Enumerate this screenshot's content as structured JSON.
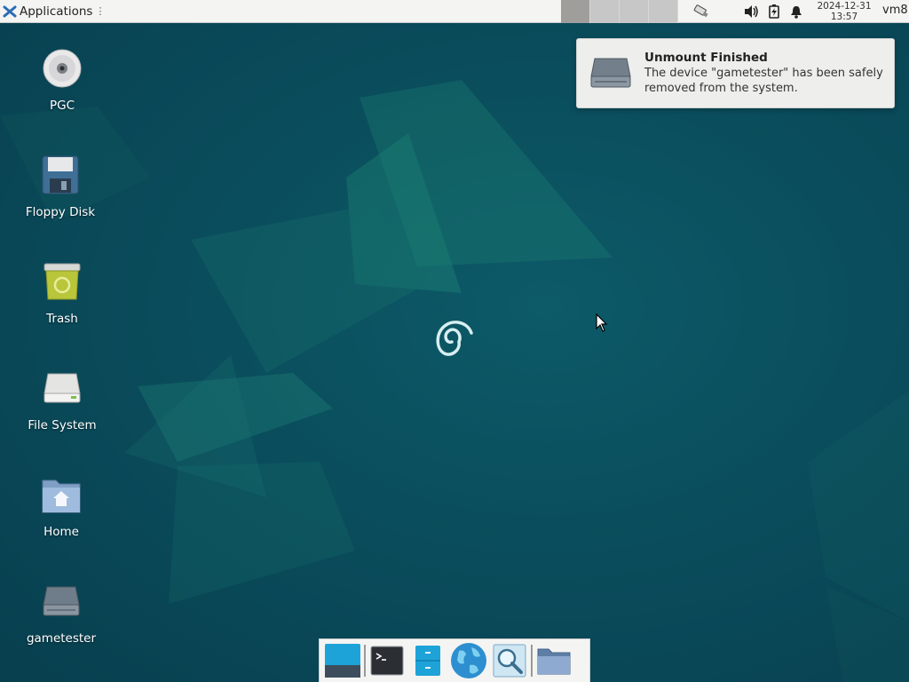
{
  "panel": {
    "apps_label": "Applications",
    "apps_separator": "⋮",
    "workspaces": [
      "1",
      "2",
      "3",
      "4"
    ],
    "active_workspace": "1",
    "clock_date": "2024-12-31",
    "clock_time": "13:57",
    "hostname": "vm8"
  },
  "tray": [
    "usb-drive-icon",
    "volume-icon",
    "battery-icon",
    "notification-bell-icon"
  ],
  "desktop": {
    "icons": [
      {
        "label": "PGC",
        "icon": "optical-disc-icon"
      },
      {
        "label": "Floppy Disk",
        "icon": "floppy-disk-icon"
      },
      {
        "label": "Trash",
        "icon": "trash-icon"
      },
      {
        "label": "File System",
        "icon": "hard-drive-icon"
      },
      {
        "label": "Home",
        "icon": "home-folder-icon"
      },
      {
        "label": "gametester",
        "icon": "drive-icon"
      }
    ]
  },
  "notification": {
    "title": "Unmount Finished",
    "body": "The device \"gametester\" has been safely removed from the system.",
    "icon": "drive-icon"
  },
  "dock": [
    "show-desktop-icon",
    "terminal-icon",
    "file-manager-icon",
    "web-browser-icon",
    "app-finder-icon",
    "folder-icon"
  ],
  "colors": {
    "wallpaper": "#0a4d5c",
    "panel": "#f4f4f3",
    "notification_bg": "#eeeeec"
  }
}
